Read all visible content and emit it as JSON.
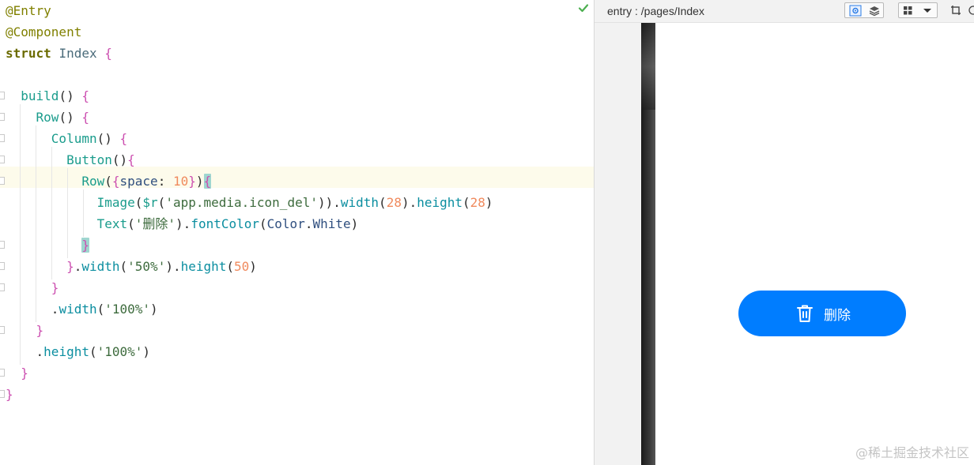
{
  "editor": {
    "lines": [
      "@Entry",
      "@Component",
      "struct Index {",
      "",
      "  build() {",
      "    Row() {",
      "      Column() {",
      "        Button(){",
      "          Row({space: 10}){",
      "            Image($r('app.media.icon_del')).width(28).height(28)",
      "            Text('删除').fontColor(Color.White)",
      "          }",
      "        }.width('50%').height(50)",
      "      }",
      "      .width('100%')",
      "    }",
      "    .height('100%')",
      "  }",
      "}"
    ]
  },
  "preview": {
    "path": "entry : /pages/Index",
    "button_label": "删除"
  },
  "watermark": "@稀土掘金技术社区",
  "colors": {
    "accent": "#007dff",
    "check": "#4caf50"
  }
}
